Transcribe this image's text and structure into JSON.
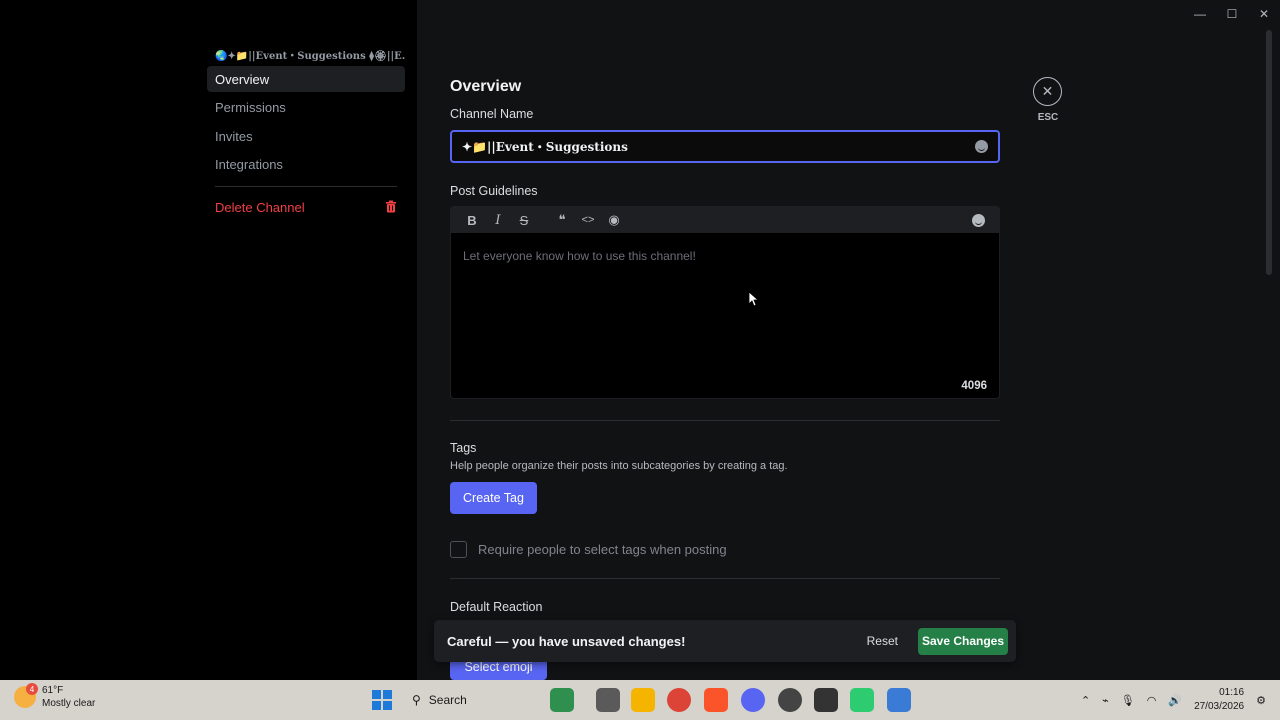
{
  "window": {
    "controls": {
      "minimize": "—",
      "maximize": "☐",
      "close": "✕"
    }
  },
  "sidebar": {
    "header": "🌏✦📁||Event・Suggestions ⧫🏵||E...",
    "items": [
      {
        "label": "Overview",
        "active": true
      },
      {
        "label": "Permissions"
      },
      {
        "label": "Invites"
      },
      {
        "label": "Integrations"
      }
    ],
    "delete_label": "Delete Channel"
  },
  "main": {
    "title": "Overview",
    "channel_name_label": "Channel Name",
    "channel_name_value": "✦📁||Event・Suggestions",
    "post_guidelines_label": "Post Guidelines",
    "guidelines_placeholder": "Let everyone know how to use this channel!",
    "char_counter": "4096",
    "tags_label": "Tags",
    "tags_help": "Help people organize their posts into subcategories by creating a tag.",
    "create_tag_label": "Create Tag",
    "require_tags_label": "Require people to select tags when posting",
    "default_reaction_label": "Default Reaction",
    "select_emoji_label": "Select emoji",
    "esc_label": "ESC"
  },
  "toolbar": {
    "bold": "B",
    "italic": "I",
    "strike": "S",
    "quote": "❝",
    "code": "<>",
    "spoiler": "◉"
  },
  "unsaved": {
    "message": "Careful — you have unsaved changes!",
    "reset_label": "Reset",
    "save_label": "Save Changes"
  },
  "taskbar": {
    "weather_temp": "61°F",
    "weather_desc": "Mostly clear",
    "weather_badge": "4",
    "search_label": "Search",
    "time": "01:16",
    "date": "27/03/2026"
  },
  "colors": {
    "accent": "#5865f2",
    "save": "#248046",
    "danger": "#f23f43"
  }
}
